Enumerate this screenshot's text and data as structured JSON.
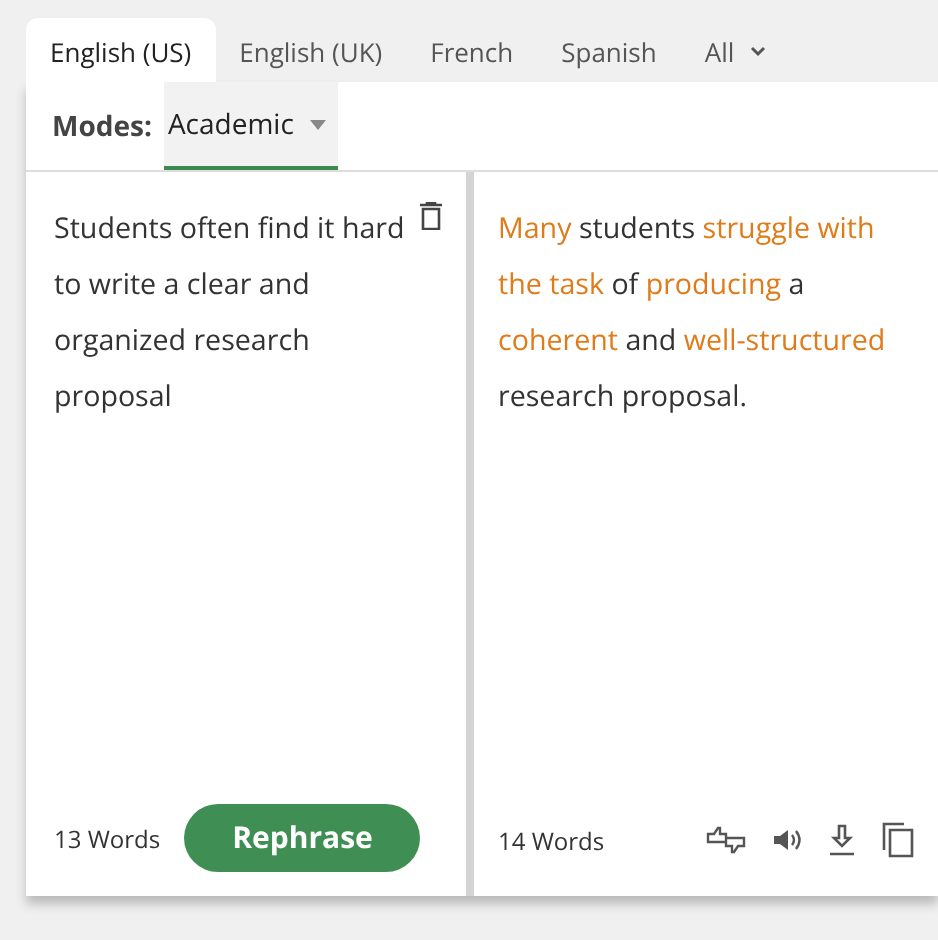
{
  "tabs": [
    {
      "label": "English (US)",
      "selected": true
    },
    {
      "label": "English (UK)",
      "selected": false
    },
    {
      "label": "French",
      "selected": false
    },
    {
      "label": "Spanish",
      "selected": false
    },
    {
      "label": "All",
      "selected": false,
      "dropdown": true
    }
  ],
  "modes": {
    "label": "Modes:",
    "value": "Academic"
  },
  "input": {
    "text": "Students often find it hard to write a clear and organized research proposal",
    "word_count": "13 Words",
    "button": "Rephrase"
  },
  "output": {
    "segments": [
      {
        "text": "Many",
        "changed": true
      },
      {
        "text": " students ",
        "changed": false
      },
      {
        "text": "struggle with the task",
        "changed": true
      },
      {
        "text": " of ",
        "changed": false
      },
      {
        "text": "producing",
        "changed": true
      },
      {
        "text": " a ",
        "changed": false
      },
      {
        "text": "coherent",
        "changed": true
      },
      {
        "text": " and ",
        "changed": false
      },
      {
        "text": "well-structured",
        "changed": true
      },
      {
        "text": " research proposal.",
        "changed": false
      }
    ],
    "word_count": "14 Words"
  }
}
